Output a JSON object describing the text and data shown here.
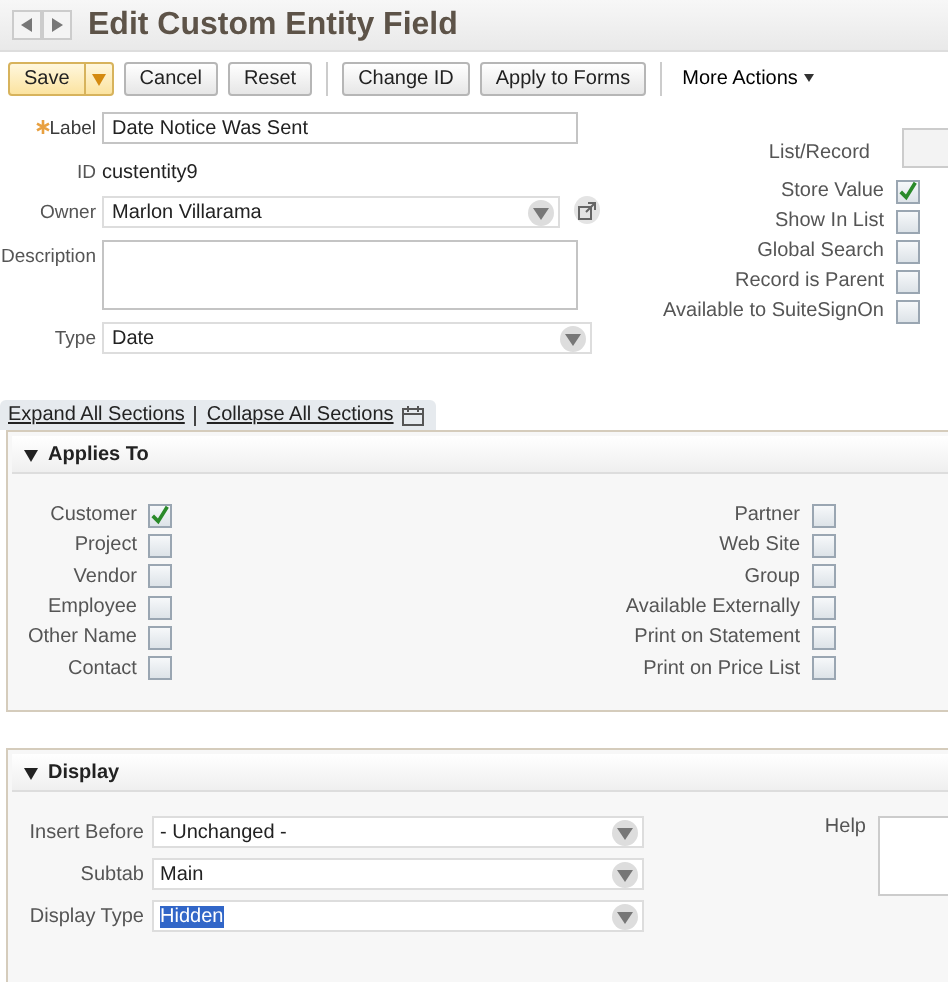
{
  "header": {
    "title": "Edit Custom Entity Field"
  },
  "toolbar": [
    {
      "buttons": [
        {
          "label": "Save",
          "kind": "split"
        },
        {
          "label": "Cancel",
          "kind": "plain"
        },
        {
          "label": "Reset",
          "kind": "plain"
        }
      ]
    },
    {
      "buttons": [
        {
          "label": "Change ID",
          "kind": "plain"
        },
        {
          "label": "Apply to Forms",
          "kind": "plain"
        }
      ]
    },
    {
      "buttons": [
        {
          "label": "More Actions",
          "kind": "menu"
        }
      ]
    }
  ],
  "fields": [
    {
      "label": "Label",
      "required": true,
      "kind": "text",
      "value": "Date Notice Was Sent"
    },
    {
      "label": "ID",
      "required": false,
      "kind": "static",
      "value": "custentity9"
    },
    {
      "label": "Owner",
      "required": false,
      "kind": "select",
      "value": "Marlon Villarama",
      "popup": true
    },
    {
      "label": "Description",
      "required": false,
      "kind": "textarea"
    },
    {
      "label": "Type",
      "required": false,
      "kind": "select",
      "value": "Date",
      "popup": false
    }
  ],
  "options": [
    {
      "label": "List/Record",
      "kind": "field"
    },
    {
      "label": "Store Value",
      "kind": "checkbox",
      "checked": true
    },
    {
      "label": "Show In List",
      "kind": "checkbox",
      "checked": false
    },
    {
      "label": "Global Search",
      "kind": "checkbox",
      "checked": false
    },
    {
      "label": "Record is Parent",
      "kind": "checkbox",
      "checked": false
    },
    {
      "label": "Available to SuiteSignOn",
      "kind": "checkbox",
      "checked": false
    }
  ],
  "section_links": [
    "Expand All Sections",
    "Collapse All Sections"
  ],
  "applies_to": {
    "title": "Applies To",
    "expanded": true,
    "left": [
      {
        "label": "Customer",
        "checked": true
      },
      {
        "label": "Project",
        "checked": false
      },
      {
        "label": "Vendor",
        "checked": false
      },
      {
        "label": "Employee",
        "checked": false
      },
      {
        "label": "Other Name",
        "checked": false
      },
      {
        "label": "Contact",
        "checked": false
      }
    ],
    "right": [
      {
        "label": "Partner",
        "checked": false
      },
      {
        "label": "Web Site",
        "checked": false
      },
      {
        "label": "Group",
        "checked": false
      },
      {
        "label": "Available Externally",
        "checked": false
      },
      {
        "label": "Print on Statement",
        "checked": false
      },
      {
        "label": "Print on Price List",
        "checked": false
      }
    ]
  },
  "display": {
    "title": "Display",
    "expanded": true,
    "fields": [
      {
        "label": "Insert Before",
        "value": "- Unchanged -",
        "value_selected": false
      },
      {
        "label": "Subtab",
        "value": "Main",
        "value_selected": false
      },
      {
        "label": "Display Type",
        "value": "Hidden",
        "value_selected": true
      }
    ],
    "help": {
      "label": "Help"
    }
  }
}
